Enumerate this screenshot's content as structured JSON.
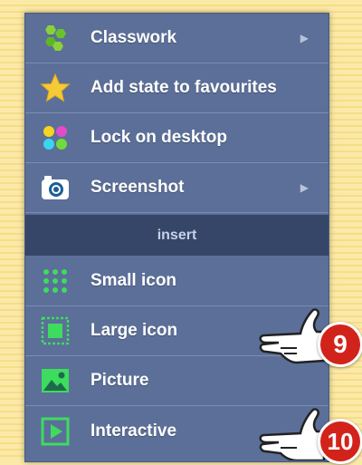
{
  "menu": {
    "items": [
      {
        "label": "Classwork",
        "icon": "hexagon-cluster-icon",
        "has_submenu": true
      },
      {
        "label": "Add state to favourites",
        "icon": "star-icon",
        "has_submenu": false
      },
      {
        "label": "Lock on desktop",
        "icon": "colored-dots-icon",
        "has_submenu": false
      },
      {
        "label": "Screenshot",
        "icon": "camera-icon",
        "has_submenu": true
      }
    ],
    "section_header": "insert",
    "insert_items": [
      {
        "label": "Small icon",
        "icon": "dot-grid-icon"
      },
      {
        "label": "Large icon",
        "icon": "large-square-icon"
      },
      {
        "label": "Picture",
        "icon": "picture-icon"
      },
      {
        "label": "Interactive",
        "icon": "play-icon"
      }
    ],
    "submenu_arrow": "▶"
  },
  "callouts": {
    "first": "9",
    "second": "10"
  },
  "colors": {
    "menu_bg": "#5b6f98",
    "section_bg": "#354668",
    "icon_green": "#3ddc5e",
    "badge_red": "#d2231b",
    "page_bg": "#fbe9a8"
  }
}
